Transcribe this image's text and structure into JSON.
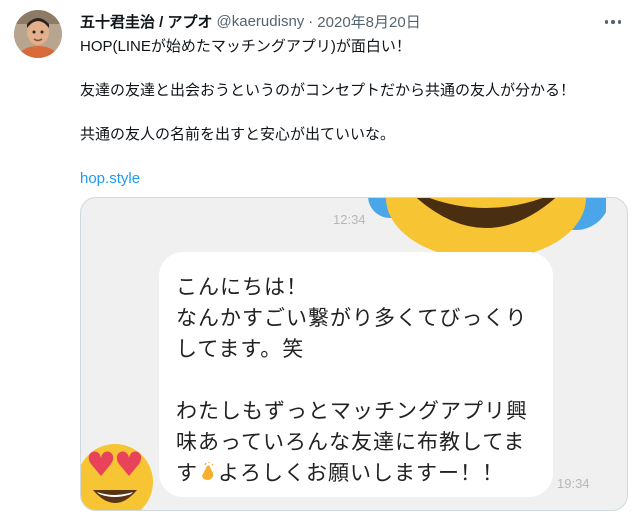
{
  "tweet": {
    "author_name": "五十君圭治 / アプオ",
    "handle": "@kaerudisny",
    "separator": "·",
    "date": "2020年8月20日",
    "more_icon": "more-icon",
    "lines": [
      "HOP(LINEが始めたマッチングアプリ)が面白い！",
      "友達の友達と出会おうというのがコンセプトだから共通の友人が分かる！",
      "共通の友人の名前を出すと安心が出ていいな。"
    ],
    "link": "hop.style"
  },
  "media": {
    "time_top": "12:34",
    "time_bottom": "19:34",
    "message_lines": [
      "こんにちは！",
      "なんかすごい繋がり多くてびっくり",
      "してます。笑",
      "",
      "わたしもずっとマッチングアプリ興",
      "味あっていろんな友達に布教してま",
      "す",
      "よろしくお願いしますー！！"
    ],
    "icons": [
      "sweat-smile-emoji",
      "heart-eyes-emoji",
      "clapping-hands-emoji"
    ]
  },
  "colors": {
    "link": "#1d9bf0",
    "text": "#0f1419",
    "muted": "#536471",
    "media_bg": "#f0f0f0"
  }
}
